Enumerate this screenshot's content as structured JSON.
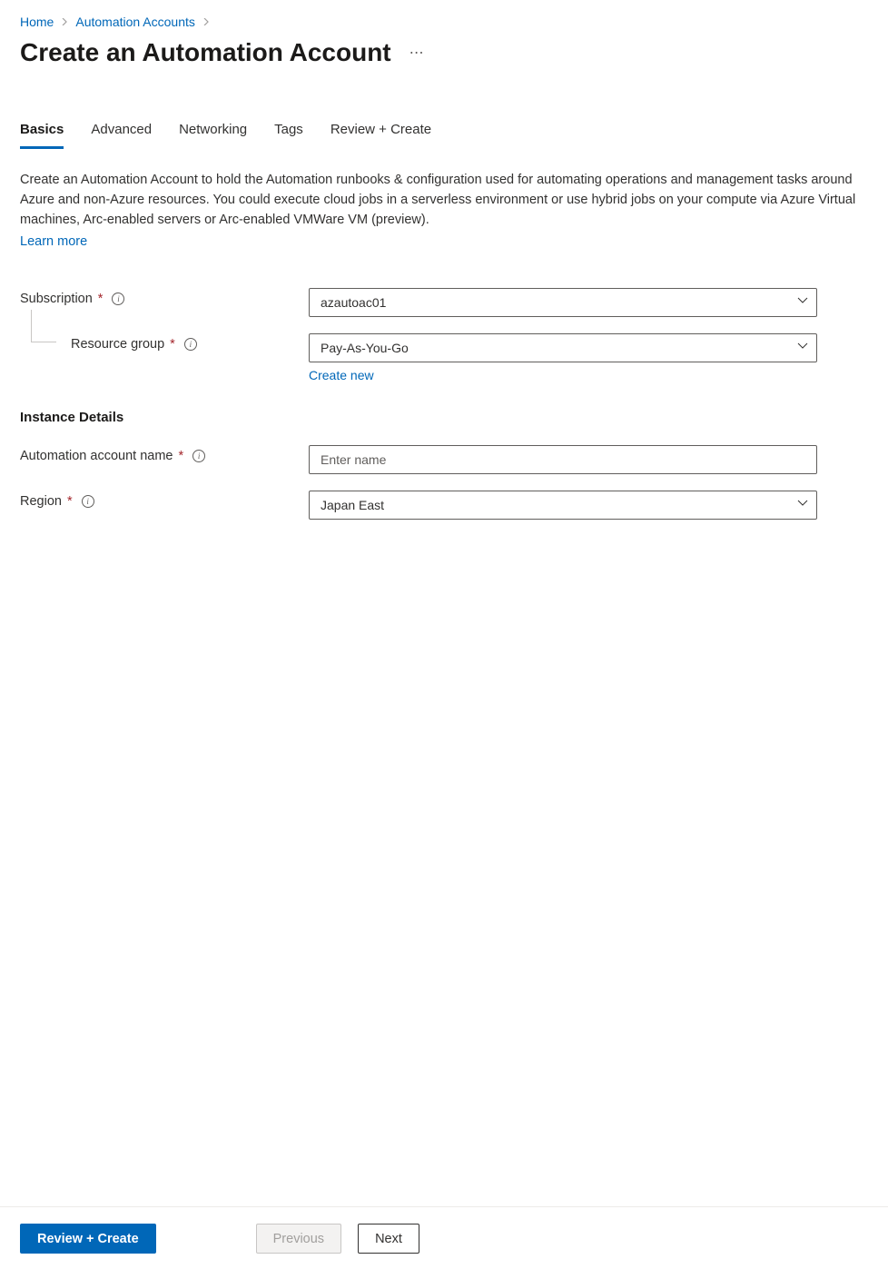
{
  "breadcrumb": {
    "items": [
      {
        "label": "Home"
      },
      {
        "label": "Automation Accounts"
      }
    ]
  },
  "page": {
    "title": "Create an Automation Account"
  },
  "tabs": [
    {
      "label": "Basics",
      "active": true
    },
    {
      "label": "Advanced",
      "active": false
    },
    {
      "label": "Networking",
      "active": false
    },
    {
      "label": "Tags",
      "active": false
    },
    {
      "label": "Review + Create",
      "active": false
    }
  ],
  "description": "Create an Automation Account to hold the Automation runbooks & configuration used for automating operations and management tasks around Azure and non-Azure resources. You could execute cloud jobs in a serverless environment or use hybrid jobs on your compute via Azure Virtual machines, Arc-enabled servers or Arc-enabled VMWare VM (preview).",
  "learn_more_label": "Learn more",
  "form": {
    "subscription": {
      "label": "Subscription",
      "value": "azautoac01"
    },
    "resource_group": {
      "label": "Resource group",
      "value": "Pay-As-You-Go",
      "create_new_label": "Create new"
    },
    "instance_header": "Instance Details",
    "account_name": {
      "label": "Automation account name",
      "placeholder": "Enter name",
      "value": ""
    },
    "region": {
      "label": "Region",
      "value": "Japan East"
    }
  },
  "footer": {
    "review_create": "Review + Create",
    "previous": "Previous",
    "next": "Next"
  }
}
